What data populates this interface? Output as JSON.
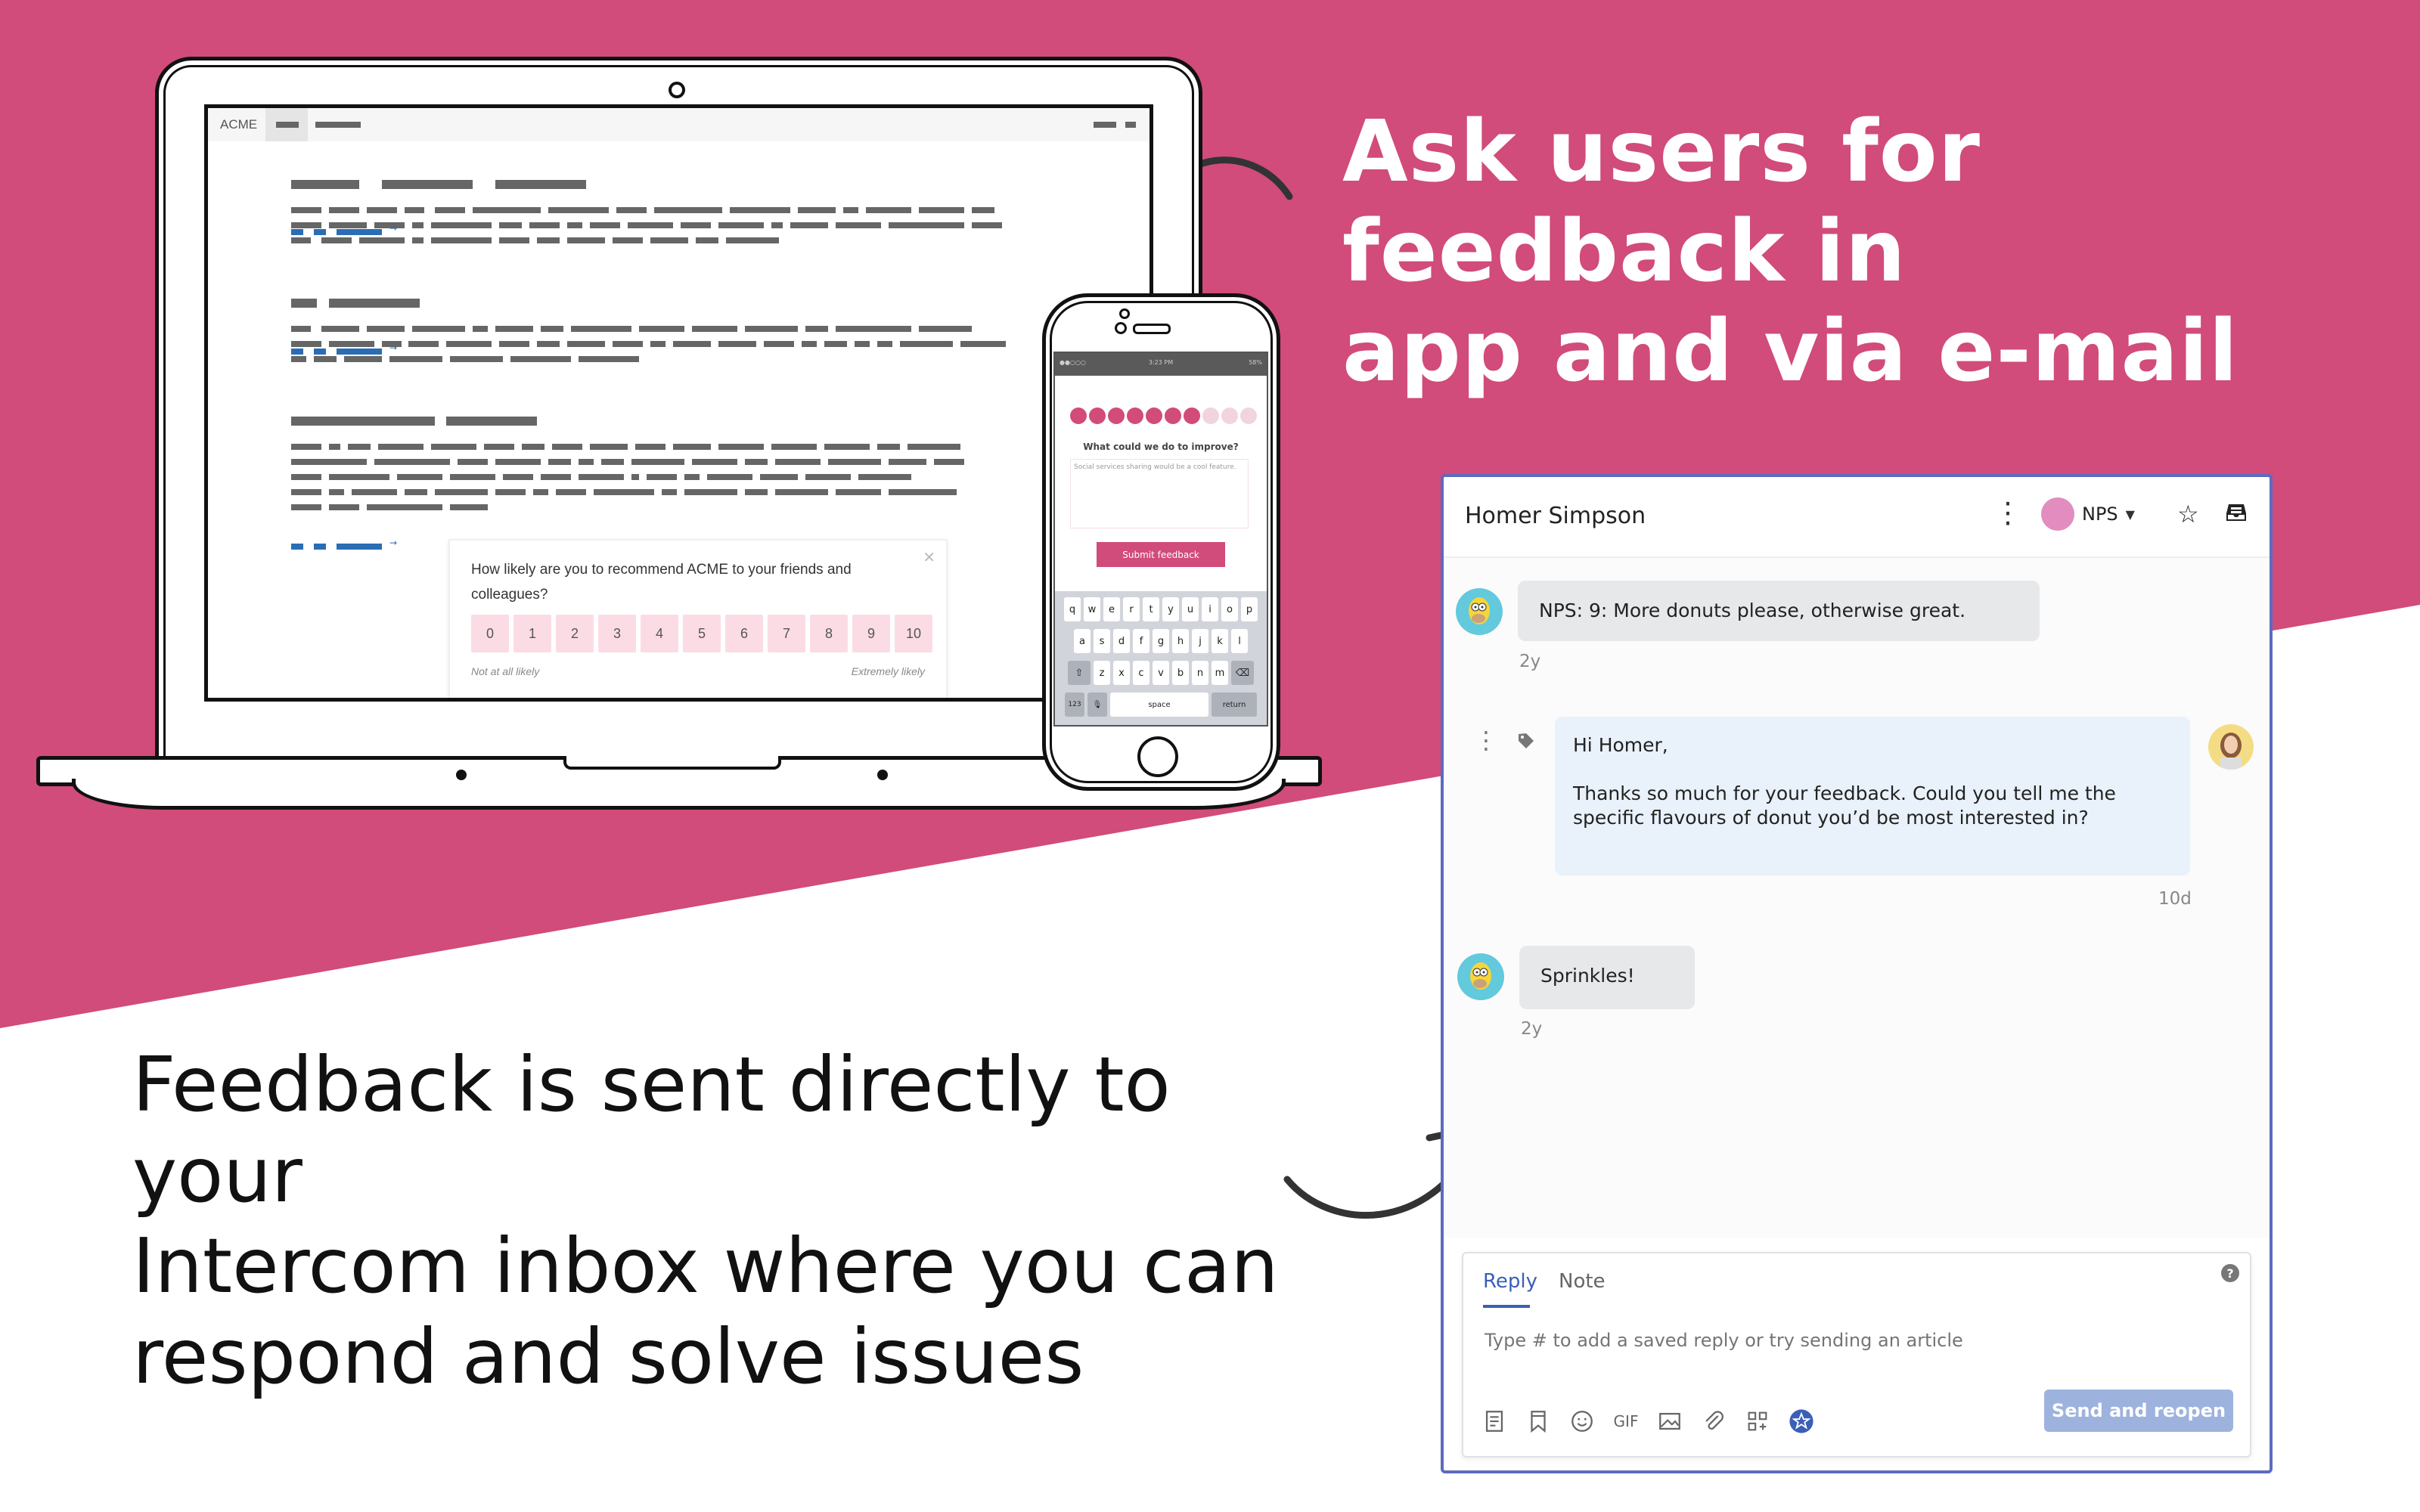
{
  "headlines": {
    "top_line1": "Ask users for feedback in",
    "top_line2": "app and via e-mail",
    "bottom_line1": "Feedback is sent directly to your",
    "bottom_line2": "Intercom inbox where you can",
    "bottom_line3": "respond and solve issues"
  },
  "colors": {
    "brand_pink": "#d14b7b",
    "panel_border": "#5c6bc0",
    "accent_blue": "#3b5fb8",
    "send_button": "#9db3de"
  },
  "laptop": {
    "app_name": "ACME",
    "nps_survey": {
      "question": "How likely are you to recommend ACME to your friends and colleagues?",
      "close_icon": "close-icon",
      "scores": [
        "0",
        "1",
        "2",
        "3",
        "4",
        "5",
        "6",
        "7",
        "8",
        "9",
        "10"
      ],
      "low_label": "Not at all likely",
      "high_label": "Extremely likely"
    }
  },
  "phone": {
    "status": {
      "signal": "●●○○○",
      "time": "3:23 PM",
      "battery": "58%"
    },
    "rating": {
      "selected": 7,
      "total": 10
    },
    "question": "What could we do to improve?",
    "answer": "Social services sharing would be a cool feature.",
    "submit_label": "Submit feedback",
    "keyboard": {
      "row1": [
        "q",
        "w",
        "e",
        "r",
        "t",
        "y",
        "u",
        "i",
        "o",
        "p"
      ],
      "row2": [
        "a",
        "s",
        "d",
        "f",
        "g",
        "h",
        "j",
        "k",
        "l"
      ],
      "row3": [
        "z",
        "x",
        "c",
        "v",
        "b",
        "n",
        "m"
      ],
      "shift": "⇧",
      "backspace": "⌫",
      "numbers": "123",
      "mic": "🎙",
      "space": "space",
      "return": "return"
    }
  },
  "inbox": {
    "title": "Homer Simpson",
    "tag_label": "NPS",
    "messages": [
      {
        "from": "user",
        "text": "NPS: 9: More donuts please, otherwise great.",
        "time": "2y"
      },
      {
        "from": "admin",
        "greeting": "Hi Homer,",
        "text": "Thanks so much for your feedback. Could you tell me the specific flavours of donut you’d be most interested in?",
        "time": "10d"
      },
      {
        "from": "user",
        "text": "Sprinkles!",
        "time": "2y"
      }
    ],
    "composer": {
      "tab_reply": "Reply",
      "tab_note": "Note",
      "placeholder": "Type # to add a saved reply or try sending an article",
      "help": "?",
      "gif_label": "GIF",
      "send_label": "Send and reopen"
    }
  }
}
